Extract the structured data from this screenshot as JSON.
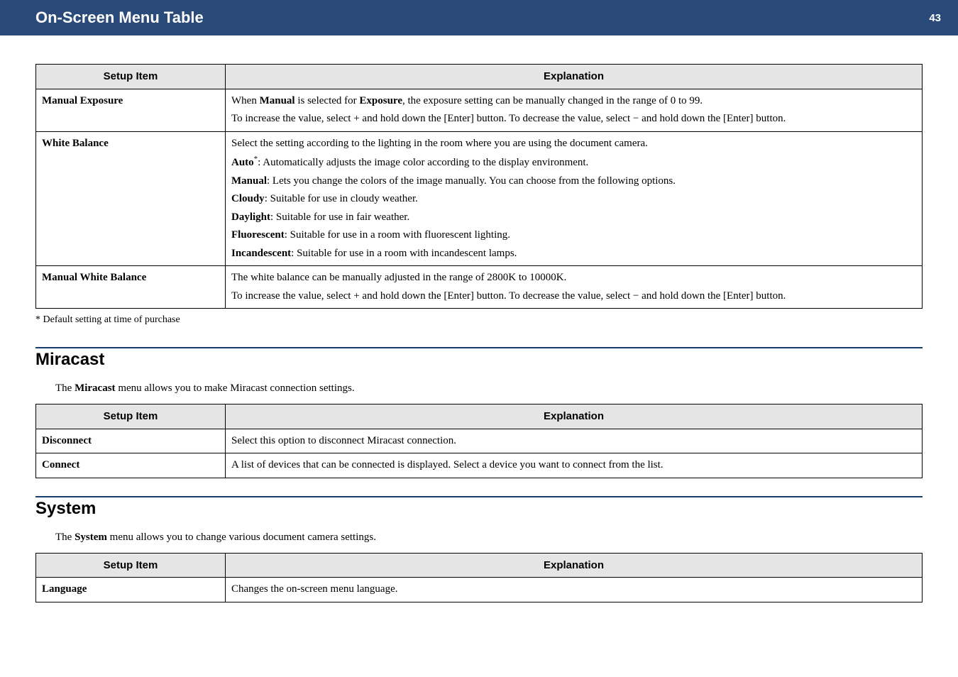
{
  "header": {
    "title": "On-Screen Menu Table",
    "page": "43"
  },
  "table1": {
    "col1": "Setup Item",
    "col2": "Explanation",
    "r1_item": "Manual Exposure",
    "r1_p1a": "When ",
    "r1_p1b": "Manual",
    "r1_p1c": " is selected for ",
    "r1_p1d": "Exposure",
    "r1_p1e": ", the exposure setting can be manually changed in the range of 0 to 99.",
    "r1_p2": "To increase the value, select + and hold down the [Enter] button. To decrease the value, select − and hold down the [Enter] button.",
    "r2_item": "White Balance",
    "r2_l1": "Select the setting according to the lighting in the room where you are using the document camera.",
    "r2_l2a": "Auto",
    "r2_l2sup": "*",
    "r2_l2b": ": Automatically adjusts the image color according to the display environment.",
    "r2_l3a": "Manual",
    "r2_l3b": ": Lets you change the colors of the image manually. You can choose from the following options.",
    "r2_l4a": "Cloudy",
    "r2_l4b": ": Suitable for use in cloudy weather.",
    "r2_l5a": "Daylight",
    "r2_l5b": ": Suitable for use in fair weather.",
    "r2_l6a": "Fluorescent",
    "r2_l6b": ": Suitable for use in a room with fluorescent lighting.",
    "r2_l7a": "Incandescent",
    "r2_l7b": ": Suitable for use in a room with incandescent lamps.",
    "r3_item": "Manual White Balance",
    "r3_l1": "The white balance can be manually adjusted in the range of 2800K to 10000K.",
    "r3_l2": "To increase the value, select + and hold down the [Enter] button. To decrease the value, select − and hold down the [Enter] button."
  },
  "footnote": "* Default setting at time of purchase",
  "miracast": {
    "title": "Miracast",
    "intro_a": "The ",
    "intro_b": "Miracast",
    "intro_c": " menu allows you to make Miracast connection settings.",
    "col1": "Setup Item",
    "col2": "Explanation",
    "r1_item": "Disconnect",
    "r1_exp": "Select this option to disconnect Miracast connection.",
    "r2_item": "Connect",
    "r2_exp": "A list of devices that can be connected is displayed. Select a device you want to connect from the list."
  },
  "system": {
    "title": "System",
    "intro_a": "The ",
    "intro_b": "System",
    "intro_c": " menu allows you to change various document camera settings.",
    "col1": "Setup Item",
    "col2": "Explanation",
    "r1_item": "Language",
    "r1_exp": "Changes the on-screen menu language."
  }
}
